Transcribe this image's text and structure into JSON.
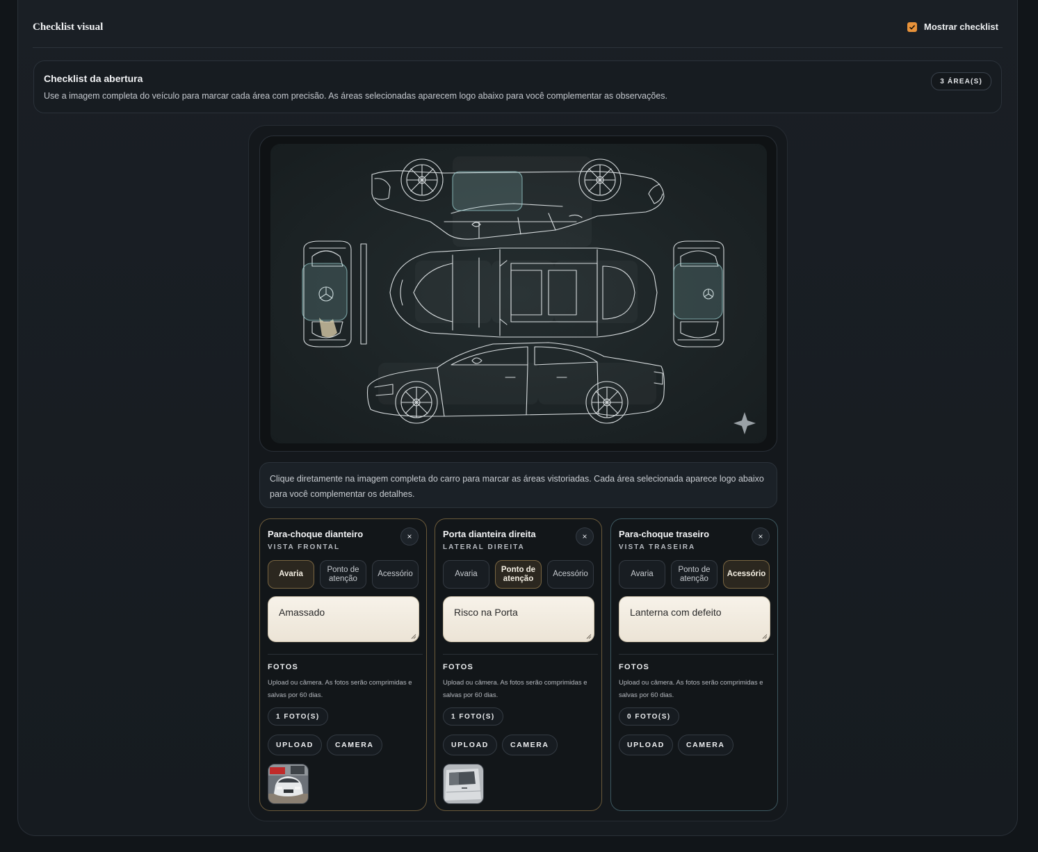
{
  "header": {
    "title": "Checklist visual",
    "toggle_label": "Mostrar checklist",
    "toggle_checked": true
  },
  "intro": {
    "title": "Checklist da abertura",
    "text": "Use a imagem completa do veículo para marcar cada área com precisão. As áreas selecionadas aparecem logo abaixo para você complementar as observações.",
    "badge": "3 ÁREA(S)"
  },
  "hint": "Clique diretamente na imagem completa do carro para marcar as áreas vistoriadas. Cada área selecionada aparece logo abaixo para você complementar os detalhes.",
  "cards": [
    {
      "title": "Para-choque dianteiro",
      "subtitle": "VISTA FRONTAL",
      "close": "×",
      "types": [
        "Avaria",
        "Ponto de atenção",
        "Acessório"
      ],
      "selected_type": "Avaria",
      "note": "Amassado",
      "fotos_label": "FOTOS",
      "fotos_desc": "Upload ou câmera. As fotos serão comprimidas e salvas por 60 dias.",
      "count": "1 FOTO(S)",
      "upload": "UPLOAD",
      "camera": "CAMERA"
    },
    {
      "title": "Porta dianteira direita",
      "subtitle": "LATERAL DIREITA",
      "close": "×",
      "types": [
        "Avaria",
        "Ponto de atenção",
        "Acessório"
      ],
      "selected_type": "Ponto de atenção",
      "note": "Risco na Porta",
      "fotos_label": "FOTOS",
      "fotos_desc": "Upload ou câmera. As fotos serão comprimidas e salvas por 60 dias.",
      "count": "1 FOTO(S)",
      "upload": "UPLOAD",
      "camera": "CAMERA"
    },
    {
      "title": "Para-choque traseiro",
      "subtitle": "VISTA TRASEIRA",
      "close": "×",
      "types": [
        "Avaria",
        "Ponto de atenção",
        "Acessório"
      ],
      "selected_type": "Acessório",
      "note": "Lanterna com defeito",
      "fotos_label": "FOTOS",
      "fotos_desc": "Upload ou câmera. As fotos serão comprimidas e salvas por 60 dias.",
      "count": "0 FOTO(S)",
      "upload": "UPLOAD",
      "camera": "CAMERA"
    }
  ],
  "colors": {
    "accent_orange": "#e8923a",
    "selected_gold": "#7a6642",
    "marked_area_teal": "#9fd6d6"
  },
  "icons": [
    "checkbox-checked-icon",
    "close-icon",
    "sparkle-icon",
    "resize-handle-icon"
  ]
}
